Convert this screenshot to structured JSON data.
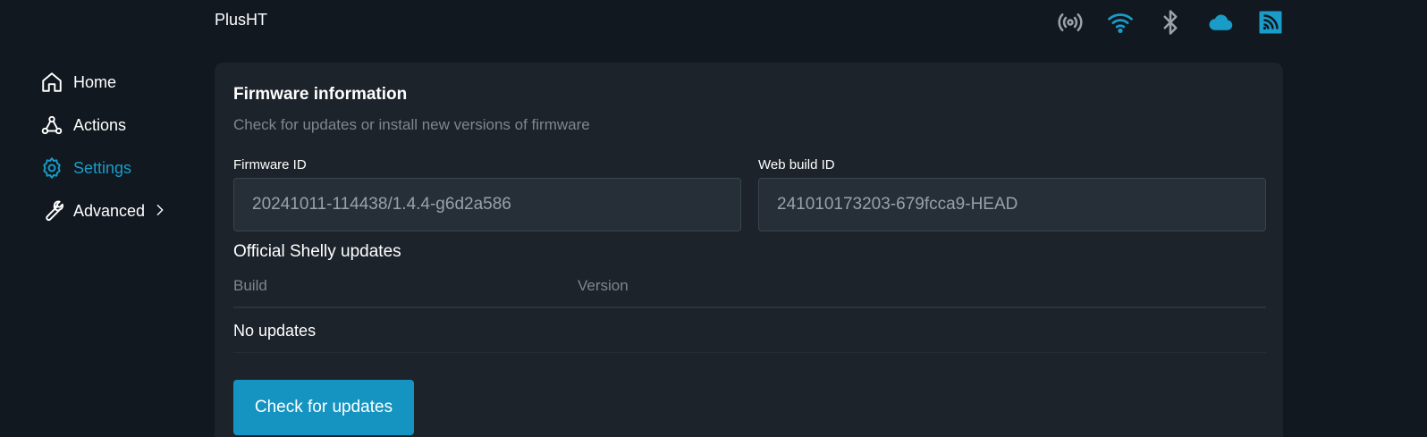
{
  "header": {
    "app_title": "PlusHT",
    "status_icons": [
      {
        "icon": "broadcast-icon",
        "color": "#9aa3ab"
      },
      {
        "icon": "wifi-icon",
        "color": "#1a9cc9"
      },
      {
        "icon": "bluetooth-icon",
        "color": "#9aa3ab"
      },
      {
        "icon": "cloud-icon",
        "color": "#1a9cc9"
      },
      {
        "icon": "rss-icon",
        "color": "#1a9cc9"
      }
    ]
  },
  "sidebar": {
    "items": [
      {
        "label": "Home",
        "icon": "home-icon",
        "active": false
      },
      {
        "label": "Actions",
        "icon": "webhook-icon",
        "active": false
      },
      {
        "label": "Settings",
        "icon": "gear-icon",
        "active": true
      },
      {
        "label": "Advanced",
        "icon": "wrench-icon",
        "active": false,
        "has_submenu": true
      }
    ]
  },
  "card": {
    "title": "Firmware information",
    "subtitle": "Check for updates or install new versions of firmware",
    "firmware_id_label": "Firmware ID",
    "firmware_id_value": "20241011-114438/1.4.4-g6d2a586",
    "web_build_id_label": "Web build ID",
    "web_build_id_value": "241010173203-679fcca9-HEAD",
    "updates_title": "Official Shelly updates",
    "columns": [
      "Build",
      "Version"
    ],
    "empty_text": "No updates",
    "check_button_label": "Check for updates"
  },
  "colors": {
    "accent": "#1a9cc9",
    "background": "#111820",
    "card": "#1c232b",
    "muted_text": "#7d8791"
  }
}
